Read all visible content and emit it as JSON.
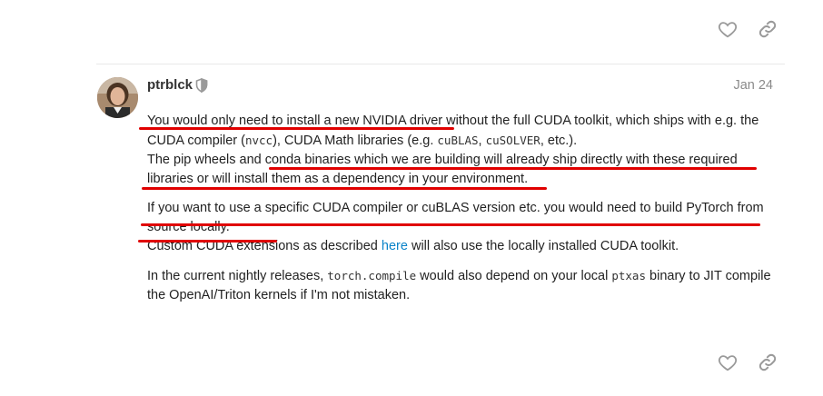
{
  "post": {
    "username": "ptrblck",
    "date": "Jan 24",
    "p1": {
      "s1": "You would only need to install a new NVIDIA driver",
      "s2": " without the full CUDA toolkit, which ships with e.g. the CUDA compiler (",
      "code1": "nvcc",
      "s3": "), CUDA Math libraries (e.g. ",
      "code2": "cuBLAS",
      "s4": ", ",
      "code3": "cuSOLVER",
      "s5": ", etc.).",
      "s6": "The pip wheels and ",
      "s7": "conda binaries which we are building will already ship directly with these required libraries or will install them as a dependency in your environment."
    },
    "p2": {
      "s1": "If you want to use a specific CUDA compiler or cuBLAS version etc. you would need to build PyTorch from source locally.",
      "s2": "Custom CUDA extensions as described ",
      "link": "here",
      "s3": " will also use the locally installed CUDA toolkit."
    },
    "p3": {
      "s1": "In the current nightly releases, ",
      "code1": "torch.compile",
      "s2": " would also depend on your local ",
      "code2": "ptxas",
      "s3": " binary to JIT compile the OpenAI/Triton kernels if I'm not mistaken."
    }
  },
  "icons": {
    "like": "heart-icon",
    "share": "link-icon",
    "moderator": "shield-icon"
  },
  "colors": {
    "annotation": "#e00000",
    "link": "#0a83c9",
    "muted": "#8a8a8a"
  }
}
